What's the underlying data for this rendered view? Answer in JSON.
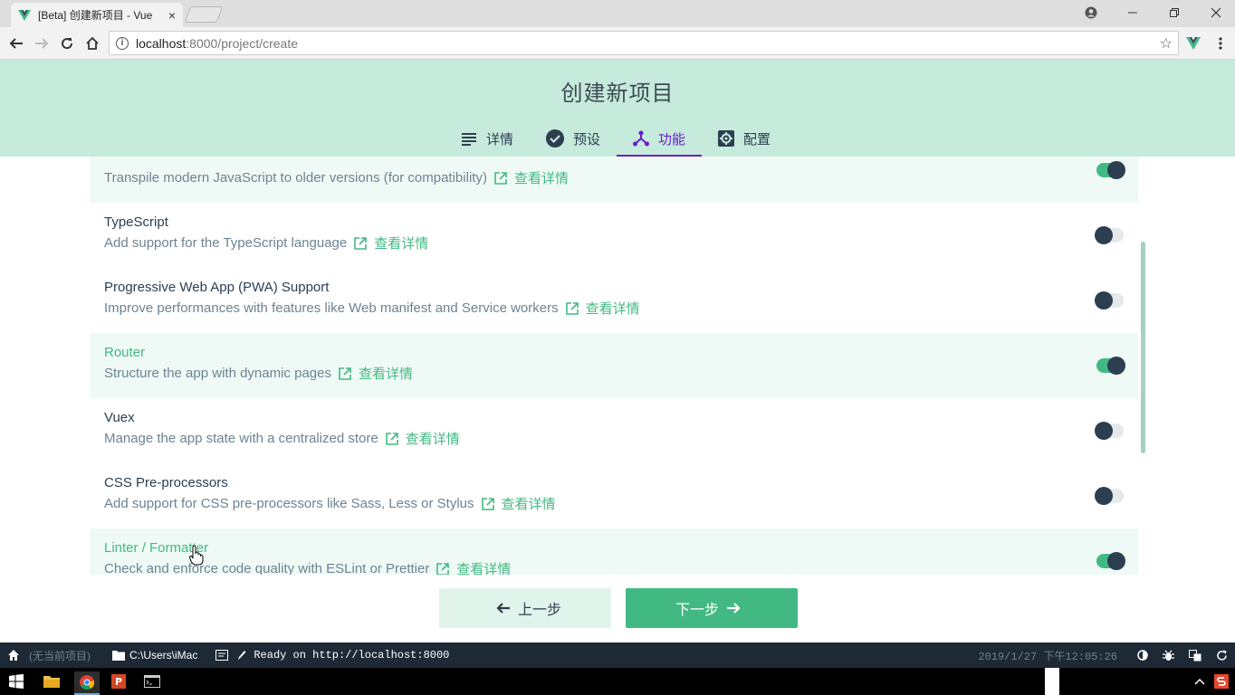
{
  "browser": {
    "tab_title": "[Beta] 创建新项目 - Vue",
    "tab_close": "×",
    "url_host": "localhost",
    "url_path": ":8000/project/create"
  },
  "header": {
    "title": "创建新项目",
    "steps": [
      {
        "label": "详情",
        "icon": "list-icon"
      },
      {
        "label": "预设",
        "icon": "check-circle-icon"
      },
      {
        "label": "功能",
        "icon": "fork-icon",
        "active": true
      },
      {
        "label": "配置",
        "icon": "settings-icon"
      }
    ]
  },
  "features": [
    {
      "name": "",
      "desc": "Transpile modern JavaScript to older versions (for compatibility)",
      "more": "查看详情",
      "enabled": true
    },
    {
      "name": "TypeScript",
      "desc": "Add support for the TypeScript language",
      "more": "查看详情",
      "enabled": false
    },
    {
      "name": "Progressive Web App (PWA) Support",
      "desc": "Improve performances with features like Web manifest and Service workers",
      "more": "查看详情",
      "enabled": false
    },
    {
      "name": "Router",
      "desc": "Structure the app with dynamic pages",
      "more": "查看详情",
      "enabled": true
    },
    {
      "name": "Vuex",
      "desc": "Manage the app state with a centralized store",
      "more": "查看详情",
      "enabled": false
    },
    {
      "name": "CSS Pre-processors",
      "desc": "Add support for CSS pre-processors like Sass, Less or Stylus",
      "more": "查看详情",
      "enabled": false
    },
    {
      "name": "Linter / Formatter",
      "desc": "Check and enforce code quality with ESLint or Prettier",
      "more": "查看详情",
      "enabled": true
    }
  ],
  "buttons": {
    "prev": "上一步",
    "next": "下一步"
  },
  "statusbar": {
    "no_project": "(无当前项目)",
    "folder": "C:\\Users\\iMac",
    "log": "Ready on http://localhost:8000",
    "datetime": "2019/1/27 下午12:05:26"
  },
  "colors": {
    "accent": "#42b983",
    "header_bg": "#c6eadc",
    "active_step": "#6a1fc9",
    "dark": "#2c3e50"
  }
}
